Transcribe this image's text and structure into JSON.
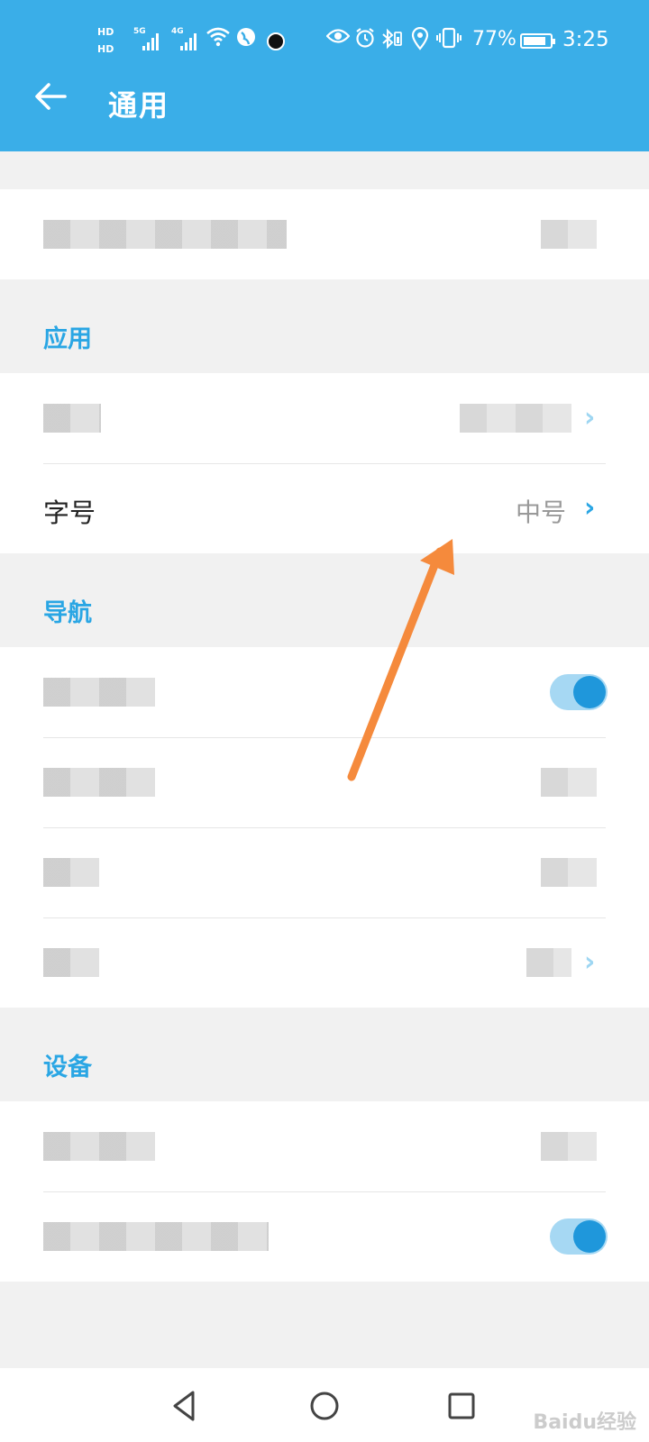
{
  "status_bar": {
    "hd1": "HD",
    "hd2": "HD",
    "net1": "5G",
    "net2": "4G",
    "battery_percent": "77%",
    "time": "3:25"
  },
  "header": {
    "title": "通用",
    "back_icon": "arrow-left-icon"
  },
  "sections": [
    {
      "title": "应用"
    },
    {
      "title": "导航"
    },
    {
      "title": "设备"
    }
  ],
  "rows": {
    "font_size_label": "字号",
    "font_size_value": "中号"
  },
  "colors": {
    "brand": "#3aaee8",
    "accent": "#2aa6e4",
    "arrow": "#f58a3c"
  },
  "watermark": "Baidu经验"
}
